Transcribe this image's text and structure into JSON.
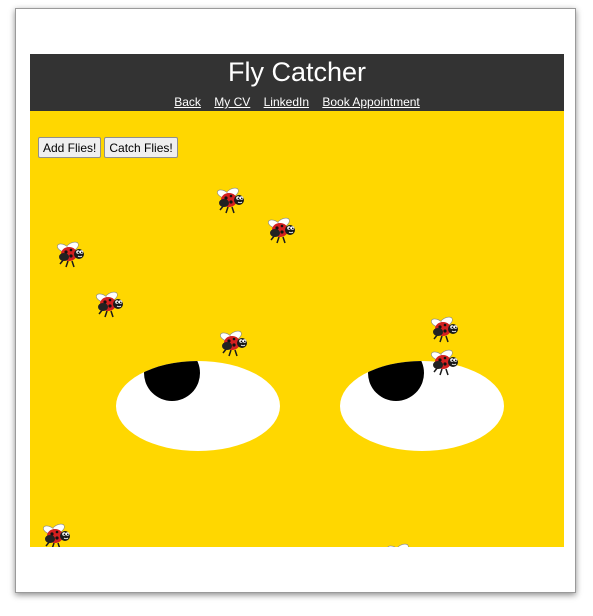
{
  "app": {
    "title": "Fly Catcher"
  },
  "nav": {
    "items": [
      {
        "label": "Back"
      },
      {
        "label": "My CV"
      },
      {
        "label": "LinkedIn"
      },
      {
        "label": "Book Appointment"
      }
    ]
  },
  "controls": {
    "add_label": "Add Flies!",
    "catch_label": "Catch Flies!"
  },
  "colors": {
    "header": "#333333",
    "game_background": "#ffd700",
    "eye": "#ffffff",
    "pupil": "#000000",
    "ladybug_shell": "#d32020"
  },
  "icons": {
    "fly": "ladybug-icon"
  }
}
